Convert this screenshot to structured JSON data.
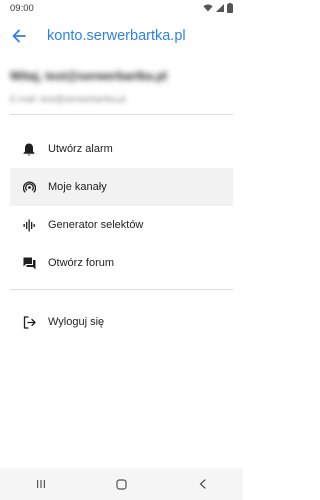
{
  "status_bar": {
    "time": "09:00",
    "icons": [
      "wifi-icon",
      "signal-icon",
      "battery-icon"
    ]
  },
  "app_bar": {
    "back_icon": "arrow-back-icon",
    "title": "konto.serwerbartka.pl"
  },
  "profile": {
    "name": "Witaj, test@serwerbartka.pl",
    "email": "E-mail: test@serwerbartka.pl"
  },
  "menu": {
    "items": [
      {
        "icon": "bell-icon",
        "label": "Utwórz alarm"
      },
      {
        "icon": "podcast-icon",
        "label": "Moje kanały"
      },
      {
        "icon": "waveform-icon",
        "label": "Generator selektów"
      },
      {
        "icon": "forum-icon",
        "label": "Otwórz forum"
      }
    ],
    "logout": {
      "icon": "logout-icon",
      "label": "Wyloguj się"
    }
  },
  "nav_bar": {
    "buttons": [
      "recents-icon",
      "home-icon",
      "back-icon"
    ]
  },
  "colors": {
    "accent": "#2f80ed",
    "active_row": "#f2f2f2",
    "divider": "#dcdcdc"
  }
}
